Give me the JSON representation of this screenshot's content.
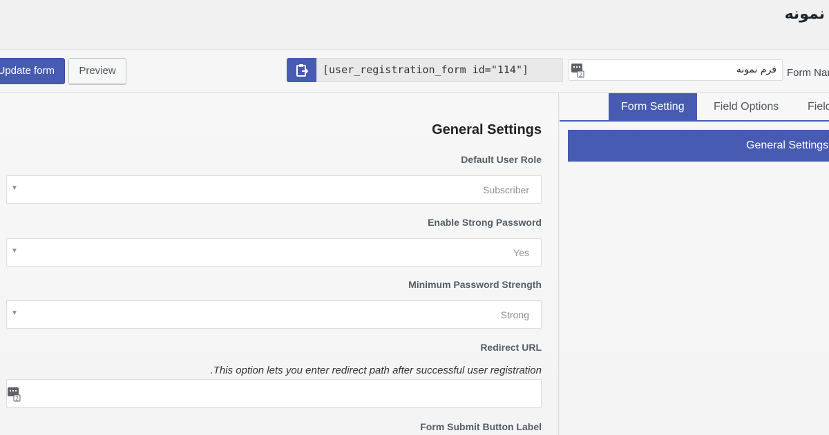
{
  "page": {
    "title": "نمونه"
  },
  "toolbar": {
    "update_label": "Update form",
    "preview_label": "Preview",
    "copy_icon": "clipboard-icon",
    "shortcode": "[user_registration_form id=\"114\"]",
    "form_name_value": "فرم نمونه",
    "form_name_label": "Form Name",
    "keyboard_icon": "keyboard-icon"
  },
  "settings": {
    "section_title": "General Settings",
    "default_role": {
      "label": "Default User Role",
      "value": "Subscriber"
    },
    "strong_password": {
      "label": "Enable Strong Password",
      "value": "Yes"
    },
    "min_strength": {
      "label": "Minimum Password Strength",
      "value": "Strong"
    },
    "redirect": {
      "label": "Redirect URL",
      "help": ".This option lets you enter redirect path after successful user registration",
      "value": ""
    },
    "submit_label": {
      "label": "Form Submit Button Label"
    }
  },
  "sidebar": {
    "tabs": [
      {
        "label": "Form Setting",
        "active": true
      },
      {
        "label": "Field Options",
        "active": false
      },
      {
        "label": "Field",
        "active": false
      }
    ],
    "accordion_title": "General Settings"
  },
  "colors": {
    "accent": "#475bb2",
    "background": "#f1f1f1"
  }
}
